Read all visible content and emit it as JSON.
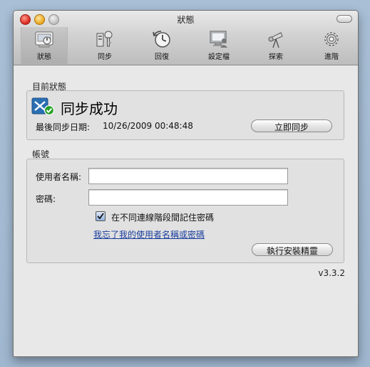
{
  "window": {
    "title": "狀態"
  },
  "toolbar": {
    "items": [
      {
        "label": "狀態",
        "icon": "status-icon",
        "selected": true
      },
      {
        "label": "同步",
        "icon": "sync-icon"
      },
      {
        "label": "回復",
        "icon": "restore-icon"
      },
      {
        "label": "設定檔",
        "icon": "profile-icon"
      },
      {
        "label": "探索",
        "icon": "discover-icon"
      },
      {
        "label": "進階",
        "icon": "advanced-gear-icon"
      }
    ]
  },
  "status": {
    "section_label": "目前狀態",
    "headline": "同步成功",
    "last_sync_label": "最後同步日期:",
    "last_sync_value": "10/26/2009 00:48:48",
    "sync_now_button": "立即同步"
  },
  "account": {
    "section_label": "帳號",
    "username_label": "使用者名稱:",
    "username_value": "",
    "password_label": "密碼:",
    "password_value": "",
    "remember_label": "在不同連線階段間記住密碼",
    "remember_checked": true,
    "forgot_link": "我忘了我的使用者名稱或密碼",
    "wizard_button": "執行安裝精靈"
  },
  "version": "v3.3.2",
  "colors": {
    "success": "#28a12a",
    "link": "#1b3f9e",
    "status_icon_blue": "#2a6fb3"
  }
}
